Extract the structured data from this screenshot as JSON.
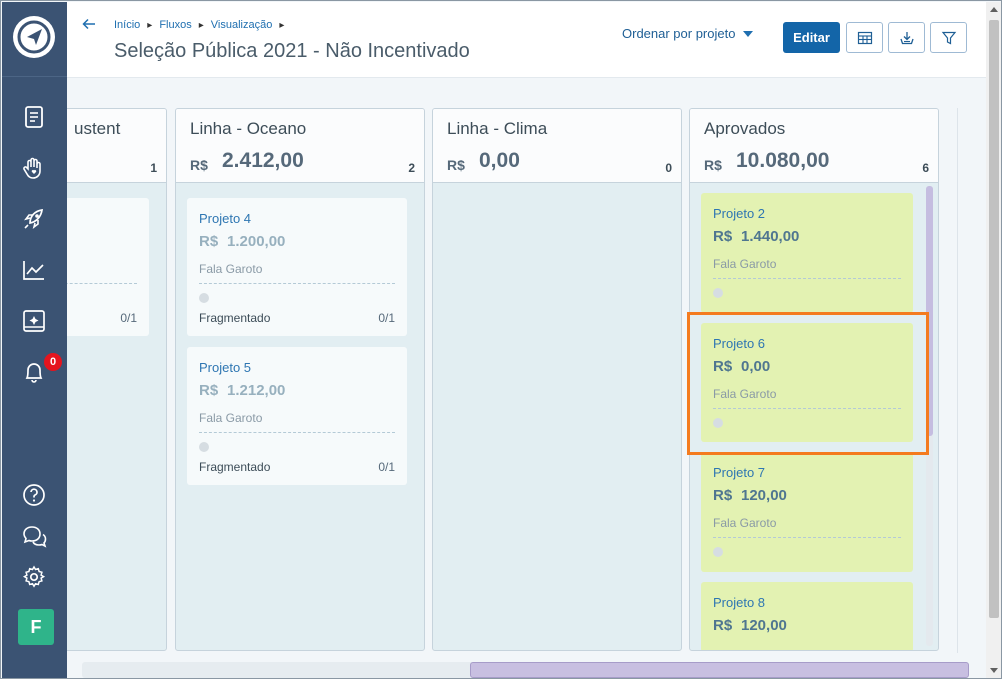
{
  "breadcrumb": {
    "items": [
      "Início",
      "Fluxos",
      "Visualização"
    ]
  },
  "page": {
    "title": "Seleção Pública 2021 - Não Incentivado"
  },
  "toolbar": {
    "sort_label": "Ordenar por projeto",
    "edit_label": "Editar"
  },
  "sidebar": {
    "notification_count": "0",
    "avatar_letter": "F"
  },
  "columns": [
    {
      "name": "ustent",
      "currency": "",
      "total": "",
      "count": "1",
      "cards": [
        {
          "name": "",
          "currency": "",
          "value": "",
          "org": "",
          "type": "",
          "progress": "0/1"
        }
      ]
    },
    {
      "name": "Linha - Oceano",
      "currency": "R$",
      "total": "2.412,00",
      "count": "2",
      "cards": [
        {
          "name": "Projeto 4",
          "currency": "R$",
          "value": "1.200,00",
          "org": "Fala Garoto",
          "type": "Fragmentado",
          "progress": "0/1"
        },
        {
          "name": "Projeto 5",
          "currency": "R$",
          "value": "1.212,00",
          "org": "Fala Garoto",
          "type": "Fragmentado",
          "progress": "0/1"
        }
      ]
    },
    {
      "name": "Linha - Clima",
      "currency": "R$",
      "total": "0,00",
      "count": "0",
      "cards": []
    },
    {
      "name": "Aprovados",
      "currency": "R$",
      "total": "10.080,00",
      "count": "6",
      "cards": [
        {
          "name": "Projeto 2",
          "currency": "R$",
          "value": "1.440,00",
          "org": "Fala Garoto"
        },
        {
          "name": "Projeto 6",
          "currency": "R$",
          "value": "0,00",
          "org": "Fala Garoto"
        },
        {
          "name": "Projeto 7",
          "currency": "R$",
          "value": "120,00",
          "org": "Fala Garoto"
        },
        {
          "name": "Projeto 8",
          "currency": "R$",
          "value": "120,00",
          "org": ""
        }
      ]
    }
  ],
  "icons": {
    "logo": "navigation-logo-icon",
    "documents": "document-icon",
    "hand": "hand-heart-icon",
    "rocket": "rocket-icon",
    "chart": "chart-line-icon",
    "image": "image-sparkle-icon",
    "bell": "bell-icon",
    "help": "help-icon",
    "chat": "chat-icon",
    "settings": "gear-icon",
    "table": "table-icon",
    "download": "download-icon",
    "filter": "filter-icon"
  },
  "colors": {
    "sidebar": "#3b5373",
    "primary": "#1365a8",
    "approved_card": "#e3f2b2",
    "highlight": "#f47b1f",
    "badge": "#e5141e",
    "avatar": "#2fb48a"
  }
}
